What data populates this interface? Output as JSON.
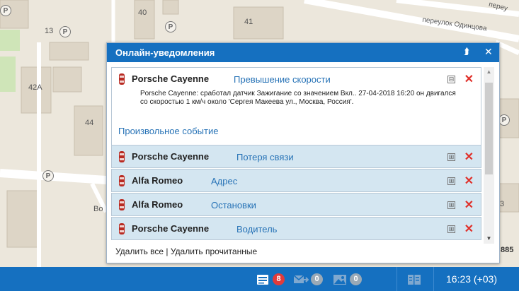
{
  "map": {
    "labels": [
      "40",
      "41",
      "13",
      "42А",
      "44",
      "Во",
      "3",
      "885"
    ],
    "street": "переулок Одинцова",
    "street_top": "переу"
  },
  "panel": {
    "title": "Онлайн-уведомления",
    "collapse_icon": "double-chevron-up",
    "close_icon": "close",
    "items": [
      {
        "name": "Porsche Cayenne",
        "event": "Превышение скорости",
        "description": "Porsche Cayenne: сработал датчик Зажигание со значением Вкл.. 27-04-2018 16:20 он двигался со скоростью 1 км/ч около 'Сергея Макеева ул., Москва, Россия'.",
        "link": "Произвольное событие",
        "toggle": "⊟"
      },
      {
        "name": "Porsche Cayenne",
        "event": "Потеря связи",
        "toggle": "⊞"
      },
      {
        "name": "Alfa Romeo",
        "event": "Адрес",
        "toggle": "⊞"
      },
      {
        "name": "Alfa Romeo",
        "event": "Остановки",
        "toggle": "⊞"
      },
      {
        "name": "Porsche Cayenne",
        "event": "Водитель",
        "toggle": "⊞"
      }
    ],
    "footer": {
      "delete_all": "Удалить все",
      "separator": " | ",
      "delete_read": "Удалить прочитанные"
    }
  },
  "taskbar": {
    "notifications_count": "8",
    "messages_count": "0",
    "images_count": "0",
    "clock": "16:23 (+03)",
    "colors": {
      "red_badge": "#e23b3b",
      "grey_badge": "#9aa9b6"
    }
  }
}
